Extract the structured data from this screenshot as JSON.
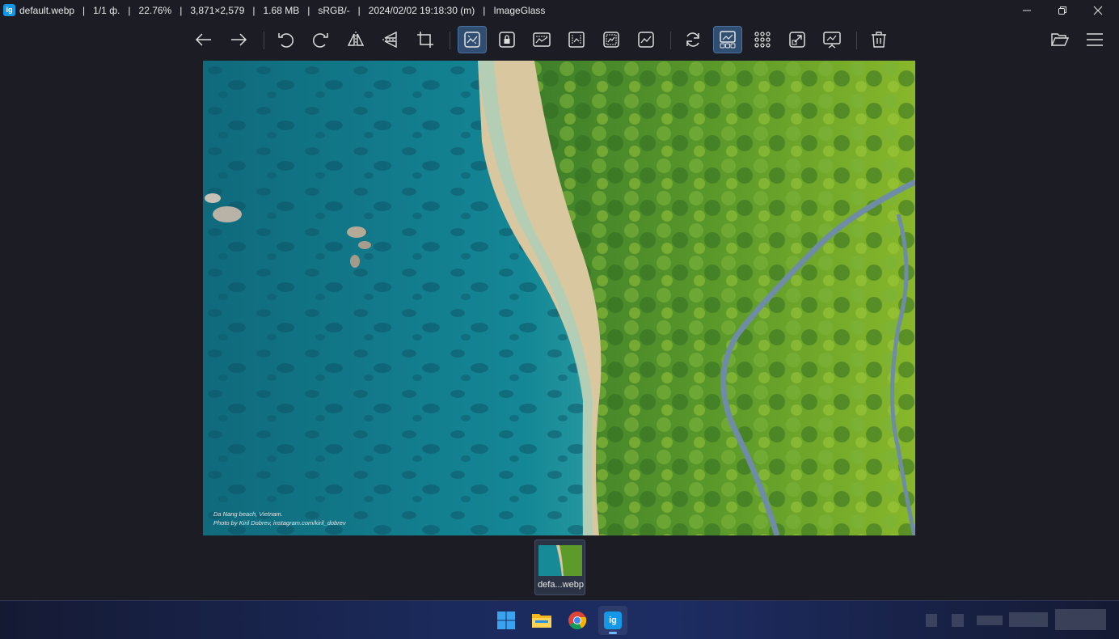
{
  "titlebar": {
    "app_icon_text": "ig",
    "title": "default.webp   |   1/1 ф.   |   22.76%   |   3,871×2,579   |   1.68 MB   |   sRGB/-   |   2024/02/02 19:18:30 (m)   |   ImageGlass",
    "minimize_icon": "minimize-icon",
    "maximize_icon": "restore-icon",
    "close_icon": "close-icon"
  },
  "toolbar": {
    "buttons": [
      "arrow-left-icon",
      "arrow-right-icon",
      "rotate-left-icon",
      "rotate-right-icon",
      "flip-horizontal-icon",
      "flip-vertical-icon",
      "crop-icon",
      "auto-zoom-icon",
      "lock-zoom-icon",
      "scale-to-width-icon",
      "scale-to-height-icon",
      "scale-to-fit-icon",
      "scale-to-fill-icon",
      "refresh-icon",
      "thumbnail-bar-icon",
      "gallery-grid-icon",
      "fullscreen-icon",
      "slideshow-icon",
      "delete-icon",
      "open-folder-icon",
      "menu-icon"
    ],
    "active": [
      "auto-zoom-icon",
      "thumbnail-bar-icon"
    ]
  },
  "image": {
    "caption_line1": "Da Nang beach, Vietnam.",
    "caption_line2": "Photo by Kiril Dobrev, instagram.com/kiril_dobrev"
  },
  "thumbnail": {
    "label": "defa...webp"
  },
  "taskbar": {
    "apps": [
      "windows-start-icon",
      "file-explorer-icon",
      "chrome-icon",
      "imageglass-icon"
    ],
    "active_app": "imageglass-icon",
    "imageglass_icon_text": "ig"
  },
  "colors": {
    "background": "#1c1d24",
    "accent": "#2f4e72",
    "taskbar": "#1b2a5c"
  }
}
